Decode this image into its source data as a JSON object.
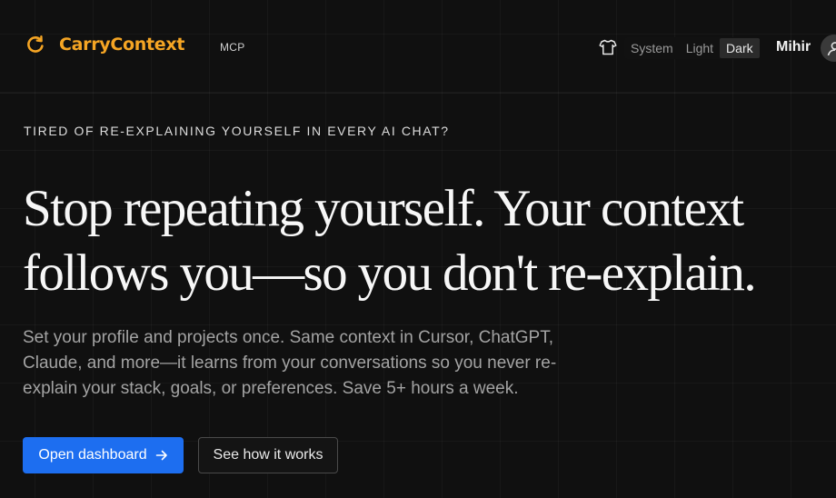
{
  "header": {
    "brand_name": "CarryContext",
    "brand_badge": "MCP",
    "brand_icon": "refresh-circle-icon",
    "accent_color": "#f5a524",
    "theme_icon": "shirt-icon",
    "theme_options": [
      "System",
      "Light",
      "Dark"
    ],
    "theme_selected": "Dark",
    "user_name": "Mihir",
    "avatar_icon": "user-icon"
  },
  "hero": {
    "eyebrow": "TIRED OF RE-EXPLAINING YOURSELF IN EVERY AI CHAT?",
    "headline": "Stop repeating yourself. Your context follows you—so you don't re-explain.",
    "subtext": "Set your profile and projects once. Same context in Cursor, ChatGPT, Claude, and more—it learns from your conversations so you never re-explain your stack, goals, or preferences. Save 5+ hours a week.",
    "primary_button": "Open dashboard",
    "primary_button_icon": "arrow-right-icon",
    "primary_color": "#1d6ef0",
    "secondary_button": "See how it works"
  }
}
